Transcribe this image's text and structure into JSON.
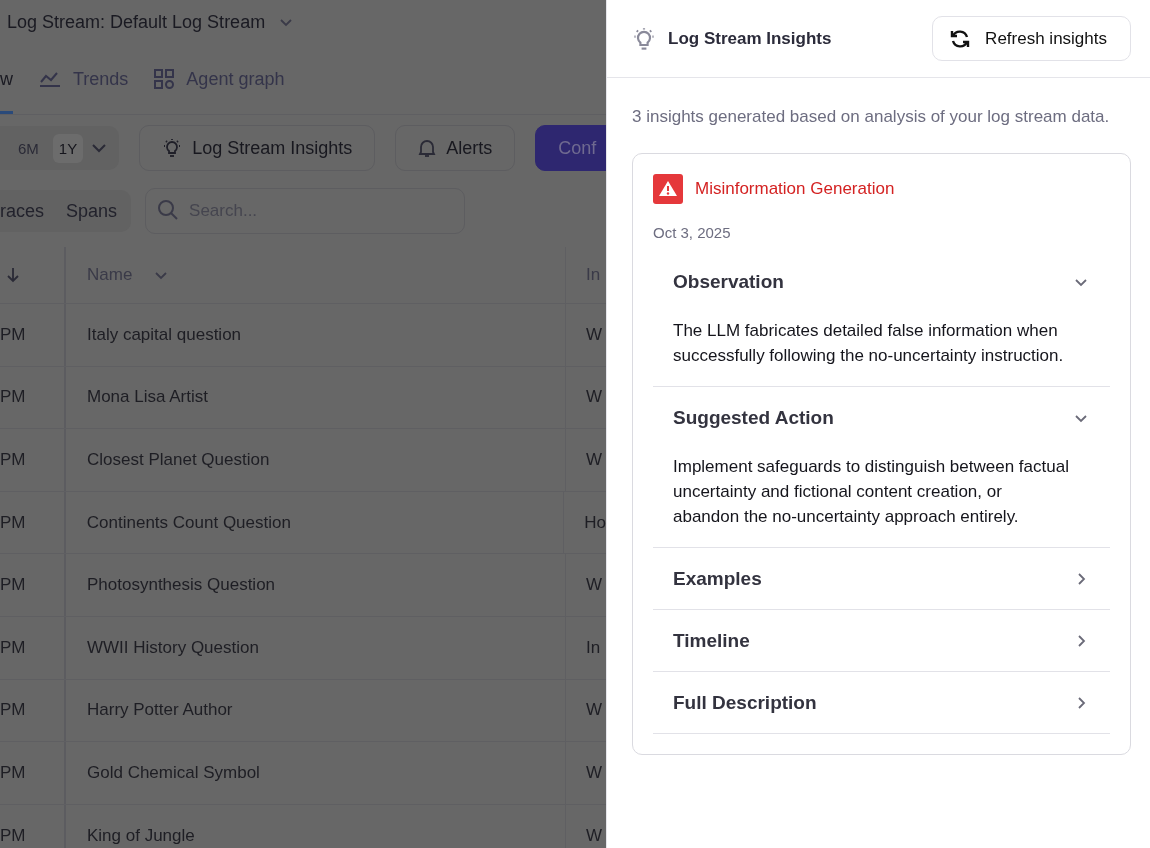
{
  "main": {
    "title": "Log Stream: Default Log Stream",
    "tabs": [
      {
        "label": "w",
        "selected": true,
        "kind": "none"
      },
      {
        "label": "Trends",
        "selected": false,
        "kind": "trend"
      },
      {
        "label": "Agent graph",
        "selected": false,
        "kind": "grid"
      }
    ],
    "ranges": [
      {
        "label": "6M",
        "selected": false
      },
      {
        "label": "1Y",
        "selected": true
      }
    ],
    "buttons": [
      {
        "label": "Log Stream Insights",
        "kind": "bulb"
      },
      {
        "label": "Alerts",
        "kind": "bell"
      },
      {
        "label": "Conf",
        "kind": "primary"
      }
    ],
    "views": [
      {
        "label": "races",
        "selected": false
      },
      {
        "label": "Spans",
        "selected": false
      }
    ],
    "search": {
      "placeholder": "Search..."
    },
    "table": {
      "columns": [
        "Name",
        "In"
      ],
      "rows": [
        {
          "time": "PM",
          "name": "Italy capital question",
          "input": "W"
        },
        {
          "time": "PM",
          "name": "Mona Lisa Artist",
          "input": "W"
        },
        {
          "time": "PM",
          "name": "Closest Planet Question",
          "input": "W"
        },
        {
          "time": "PM",
          "name": "Continents Count Question",
          "input": "Ho"
        },
        {
          "time": "PM",
          "name": "Photosynthesis Question",
          "input": "W"
        },
        {
          "time": "PM",
          "name": "WWII History Question",
          "input": "In"
        },
        {
          "time": "PM",
          "name": "Harry Potter Author",
          "input": "W"
        },
        {
          "time": "PM",
          "name": "Gold Chemical Symbol",
          "input": "W"
        },
        {
          "time": "PM",
          "name": "King of Jungle",
          "input": "W"
        }
      ]
    }
  },
  "panel": {
    "title": "Log Stream Insights",
    "refresh": "Refresh insights",
    "summary": "3 insights generated based on analysis of your log stream data.",
    "insight": {
      "title": "Misinformation Generation",
      "date": "Oct 3, 2025",
      "sections": [
        {
          "title": "Observation",
          "expanded": true,
          "text": "The LLM fabricates detailed false information when successfully following the no-uncertainty instruction."
        },
        {
          "title": "Suggested Action",
          "expanded": true,
          "text": "Implement safeguards to distinguish between factual uncertainty and fictional content creation, or abandon the no-uncertainty approach entirely."
        },
        {
          "title": "Examples",
          "expanded": false
        },
        {
          "title": "Timeline",
          "expanded": false
        },
        {
          "title": "Full Description",
          "expanded": false
        }
      ]
    }
  }
}
